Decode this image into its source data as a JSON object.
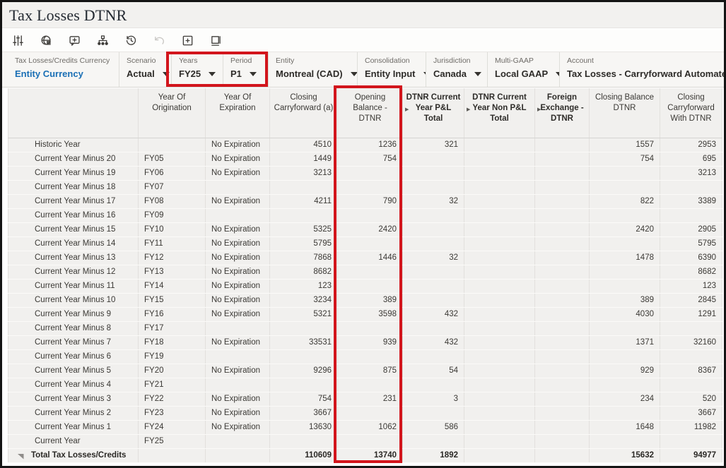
{
  "window": {
    "title": "Tax Losses DTNR"
  },
  "toolbar": {
    "icons": [
      {
        "name": "adjust-sliders-icon",
        "disabled": false
      },
      {
        "name": "currency-globe-icon",
        "disabled": false
      },
      {
        "name": "add-comment-icon",
        "disabled": false
      },
      {
        "name": "hierarchy-icon",
        "disabled": false
      },
      {
        "name": "history-icon",
        "disabled": false
      },
      {
        "name": "undo-icon",
        "disabled": true
      },
      {
        "name": "grid-icon",
        "disabled": false
      },
      {
        "name": "pop-out-icon",
        "disabled": false
      }
    ]
  },
  "pov": {
    "items": [
      {
        "label": "Tax Losses/Credits Currency",
        "value": "Entity Currency",
        "dropdown": false,
        "link": true,
        "width": 166,
        "first": true
      },
      {
        "label": "Scenario",
        "value": "Actual",
        "dropdown": true,
        "link": false,
        "width": 74
      },
      {
        "label": "Years",
        "value": "FY25",
        "dropdown": true,
        "link": false,
        "width": 73
      },
      {
        "label": "Period",
        "value": "P1",
        "dropdown": true,
        "link": false,
        "width": 64
      },
      {
        "label": "Entity",
        "value": "Montreal (CAD)",
        "dropdown": true,
        "link": false,
        "width": 126
      },
      {
        "label": "Consolidation",
        "value": "Entity Input",
        "dropdown": true,
        "link": false,
        "width": 97
      },
      {
        "label": "Jurisdiction",
        "value": "Canada",
        "dropdown": true,
        "link": false,
        "width": 87
      },
      {
        "label": "Multi-GAAP",
        "value": "Local GAAP",
        "dropdown": true,
        "link": false,
        "width": 102
      },
      {
        "label": "Account",
        "value": "Tax Losses - Carryforward Automated",
        "dropdown": true,
        "link": false,
        "width": 0
      }
    ]
  },
  "grid": {
    "columns": [
      {
        "label": "",
        "bold": false,
        "expand": false
      },
      {
        "label": "Year Of Origination",
        "bold": false,
        "expand": false
      },
      {
        "label": "Year Of Expiration",
        "bold": false,
        "expand": false
      },
      {
        "label": "Closing Carryforward (a)",
        "bold": false,
        "expand": false
      },
      {
        "label": "Opening Balance - DTNR",
        "bold": false,
        "expand": false
      },
      {
        "label": "DTNR Current Year P&L Total",
        "bold": true,
        "expand": true
      },
      {
        "label": "DTNR Current Year Non P&L Total",
        "bold": true,
        "expand": true
      },
      {
        "label": "Foreign Exchange - DTNR",
        "bold": true,
        "expand": true
      },
      {
        "label": "Closing Balance DTNR",
        "bold": false,
        "expand": false
      },
      {
        "label": "Closing Carryforward With DTNR",
        "bold": false,
        "expand": false
      }
    ],
    "rows": [
      {
        "label": "Historic Year",
        "cells": [
          "",
          "No Expiration",
          "4510",
          "1236",
          "321",
          "",
          "",
          "1557",
          "2953"
        ],
        "total": false
      },
      {
        "label": "Current Year Minus 20",
        "cells": [
          "FY05",
          "No Expiration",
          "1449",
          "754",
          "",
          "",
          "",
          "754",
          "695"
        ],
        "total": false
      },
      {
        "label": "Current Year Minus 19",
        "cells": [
          "FY06",
          "No Expiration",
          "3213",
          "",
          "",
          "",
          "",
          "",
          "3213"
        ],
        "total": false
      },
      {
        "label": "Current Year Minus 18",
        "cells": [
          "FY07",
          "",
          "",
          "",
          "",
          "",
          "",
          "",
          ""
        ],
        "total": false
      },
      {
        "label": "Current Year Minus 17",
        "cells": [
          "FY08",
          "No Expiration",
          "4211",
          "790",
          "32",
          "",
          "",
          "822",
          "3389"
        ],
        "total": false
      },
      {
        "label": "Current Year Minus 16",
        "cells": [
          "FY09",
          "",
          "",
          "",
          "",
          "",
          "",
          "",
          ""
        ],
        "total": false
      },
      {
        "label": "Current Year Minus 15",
        "cells": [
          "FY10",
          "No Expiration",
          "5325",
          "2420",
          "",
          "",
          "",
          "2420",
          "2905"
        ],
        "total": false
      },
      {
        "label": "Current Year Minus 14",
        "cells": [
          "FY11",
          "No Expiration",
          "5795",
          "",
          "",
          "",
          "",
          "",
          "5795"
        ],
        "total": false
      },
      {
        "label": "Current Year Minus 13",
        "cells": [
          "FY12",
          "No Expiration",
          "7868",
          "1446",
          "32",
          "",
          "",
          "1478",
          "6390"
        ],
        "total": false
      },
      {
        "label": "Current Year Minus 12",
        "cells": [
          "FY13",
          "No Expiration",
          "8682",
          "",
          "",
          "",
          "",
          "",
          "8682"
        ],
        "total": false
      },
      {
        "label": "Current Year Minus 11",
        "cells": [
          "FY14",
          "No Expiration",
          "123",
          "",
          "",
          "",
          "",
          "",
          "123"
        ],
        "total": false
      },
      {
        "label": "Current Year Minus 10",
        "cells": [
          "FY15",
          "No Expiration",
          "3234",
          "389",
          "",
          "",
          "",
          "389",
          "2845"
        ],
        "total": false
      },
      {
        "label": "Current Year Minus 9",
        "cells": [
          "FY16",
          "No Expiration",
          "5321",
          "3598",
          "432",
          "",
          "",
          "4030",
          "1291"
        ],
        "total": false
      },
      {
        "label": "Current Year Minus 8",
        "cells": [
          "FY17",
          "",
          "",
          "",
          "",
          "",
          "",
          "",
          ""
        ],
        "total": false
      },
      {
        "label": "Current Year Minus 7",
        "cells": [
          "FY18",
          "No Expiration",
          "33531",
          "939",
          "432",
          "",
          "",
          "1371",
          "32160"
        ],
        "total": false
      },
      {
        "label": "Current Year Minus 6",
        "cells": [
          "FY19",
          "",
          "",
          "",
          "",
          "",
          "",
          "",
          ""
        ],
        "total": false
      },
      {
        "label": "Current Year Minus 5",
        "cells": [
          "FY20",
          "No Expiration",
          "9296",
          "875",
          "54",
          "",
          "",
          "929",
          "8367"
        ],
        "total": false
      },
      {
        "label": "Current Year Minus 4",
        "cells": [
          "FY21",
          "",
          "",
          "",
          "",
          "",
          "",
          "",
          ""
        ],
        "total": false
      },
      {
        "label": "Current Year Minus 3",
        "cells": [
          "FY22",
          "No Expiration",
          "754",
          "231",
          "3",
          "",
          "",
          "234",
          "520"
        ],
        "total": false
      },
      {
        "label": "Current Year Minus 2",
        "cells": [
          "FY23",
          "No Expiration",
          "3667",
          "",
          "",
          "",
          "",
          "",
          "3667"
        ],
        "total": false
      },
      {
        "label": "Current Year Minus 1",
        "cells": [
          "FY24",
          "No Expiration",
          "13630",
          "1062",
          "586",
          "",
          "",
          "1648",
          "11982"
        ],
        "total": false
      },
      {
        "label": "Current Year",
        "cells": [
          "FY25",
          "",
          "",
          "",
          "",
          "",
          "",
          "",
          ""
        ],
        "total": false
      },
      {
        "label": "Total Tax Losses/Credits",
        "cells": [
          "",
          "",
          "110609",
          "13740",
          "1892",
          "",
          "",
          "15632",
          "94977"
        ],
        "total": true
      }
    ]
  },
  "annotations": {
    "highlight_color": "#d2151c",
    "highlighted_pov": "Years / Period",
    "highlighted_column": "Opening Balance - DTNR"
  }
}
